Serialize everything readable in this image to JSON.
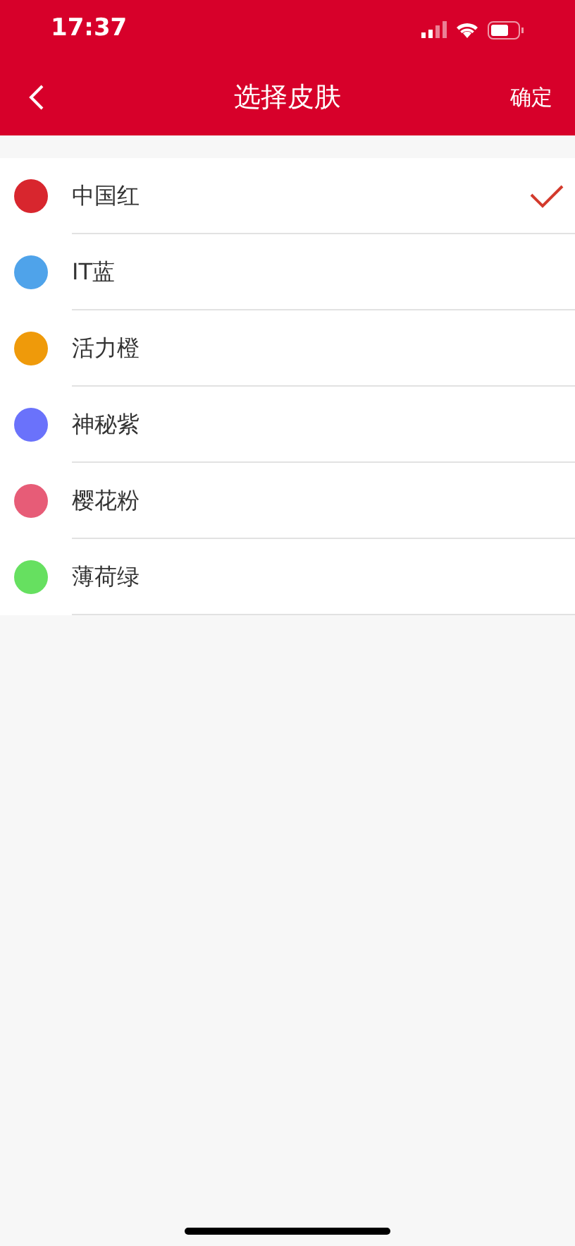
{
  "status_bar": {
    "time": "17:37"
  },
  "nav": {
    "title": "选择皮肤",
    "action": "确定"
  },
  "skins": [
    {
      "name": "中国红",
      "color": "#d8262e",
      "selected": true
    },
    {
      "name": "IT蓝",
      "color": "#4fa3ea",
      "selected": false
    },
    {
      "name": "活力橙",
      "color": "#ef9a0a",
      "selected": false
    },
    {
      "name": "神秘紫",
      "color": "#6a72fb",
      "selected": false
    },
    {
      "name": "樱花粉",
      "color": "#e75c77",
      "selected": false
    },
    {
      "name": "薄荷绿",
      "color": "#66e060",
      "selected": false
    }
  ]
}
